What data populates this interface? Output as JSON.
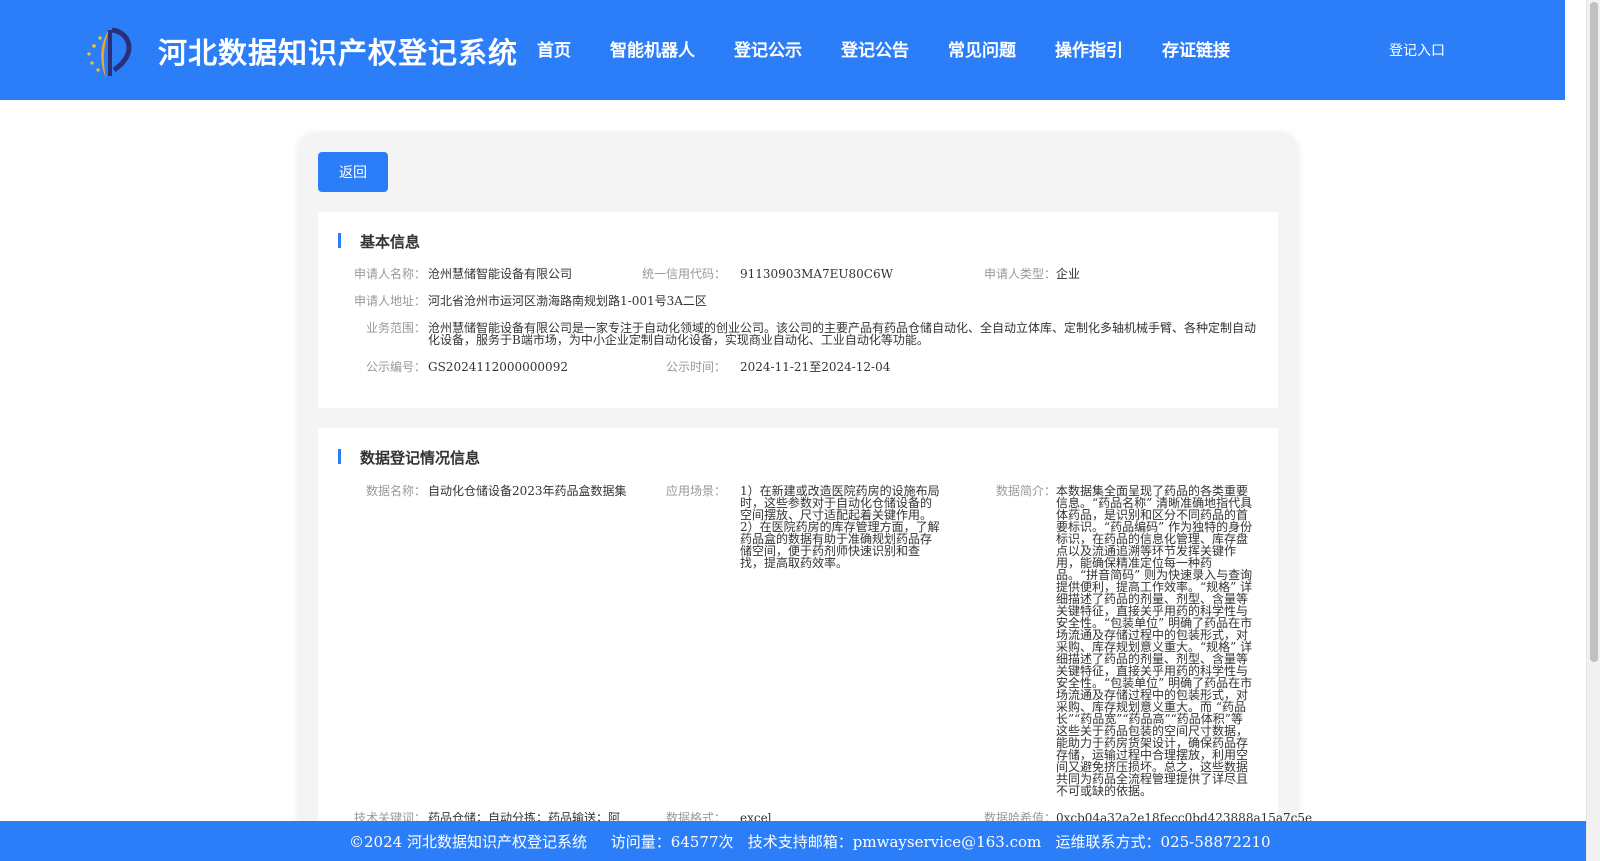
{
  "header": {
    "site_title": "河北数据知识产权登记系统",
    "nav": [
      "首页",
      "智能机器人",
      "登记公示",
      "登记公告",
      "常见问题",
      "操作指引",
      "存证链接"
    ],
    "login": "登记入口",
    "logo_icon": "pen-nib-stars-logo"
  },
  "back_button": "返回",
  "basic_info": {
    "title": "基本信息",
    "applicant_name_label": "申请人名称：",
    "applicant_name": "沧州慧储智能设备有限公司",
    "credit_code_label": "统一信用代码：",
    "credit_code": "91130903MA7EU80C6W",
    "applicant_type_label": "申请人类型：",
    "applicant_type": "企业",
    "address_label": "申请人地址：",
    "address": "河北省沧州市运河区渤海路南规划路1-001号3A二区",
    "business_label": "业务范围：",
    "business": "沧州慧储智能设备有限公司是一家专注于自动化领域的创业公司。该公司的主要产品有药品仓储自动化、全自动立体库、定制化多轴机械手臂、各种定制自动化设备，服务于B端市场，为中小企业定制自动化设备，实现商业自动化、工业自动化等功能。",
    "notice_no_label": "公示编号：",
    "notice_no": "GS2024112000000092",
    "notice_time_label": "公示时间：",
    "notice_time": "2024-11-21至2024-12-04"
  },
  "data_info": {
    "title": "数据登记情况信息",
    "data_name_label": "数据名称：",
    "data_name": "自动化仓储设备2023年药品盒数据集",
    "scenario_label": "应用场景：",
    "scenario": "1）在新建或改造医院药房的设施布局时，这些参数对于自动化仓储设备的空间摆放、尺寸适配起着关键作用。2）在医院药房的库存管理方面，了解药品盒的数据有助于准确规划药品存储空间，便于药剂师快速识别和查找，提高取药效率。",
    "summary_label": "数据简介：",
    "summary": "本数据集全面呈现了药品的各类重要信息。“药品名称” 清晰准确地指代具体药品，是识别和区分不同药品的首要标识。“药品编码” 作为独特的身份标识，在药品的信息化管理、库存盘点以及流通追溯等环节发挥关键作用，能确保精准定位每一种药品。“拼音简码” 则为快速录入与查询提供便利，提高工作效率。“规格” 详细描述了药品的剂量、剂型、含量等关键特征，直接关乎用药的科学性与安全性。“包装单位” 明确了药品在市场流通及存储过程中的包装形式，对采购、库存规划意义重大。“规格” 详细描述了药品的剂量、剂型、含量等关键特征，直接关乎用药的科学性与安全性。“包装单位” 明确了药品在市场流通及存储过程中的包装形式，对采购、库存规划意义重大。而 “药品长”“药品宽”“药品高”“药品体积”等这些关于药品包装的空间尺寸数据，能助力于药房货架设计，确保药品存存储，运输过程中合理摆放，利用空间又避免挤压损坏。总之，这些数据共同为药品全流程管理提供了详尽且不可或缺的依据。",
    "keywords_label": "技术关键词：",
    "keywords": "药品仓储；自动分拣；药品输送；阿",
    "format_label": "数据格式：",
    "format": "excel",
    "hash_label": "数据哈希值：",
    "hash": "0xcb04a32a2e18fecc0bd423888a15a7c5e"
  },
  "footer": {
    "text": "©2024 河北数据知识产权登记系统     访问量：64577次   技术支持邮箱：pmwayservice@163.com   运维联系方式：025-58872210"
  },
  "colors": {
    "primary": "#2c7ef8",
    "card_bg": "#f4f4f4",
    "label": "#999999",
    "text": "#333333"
  }
}
